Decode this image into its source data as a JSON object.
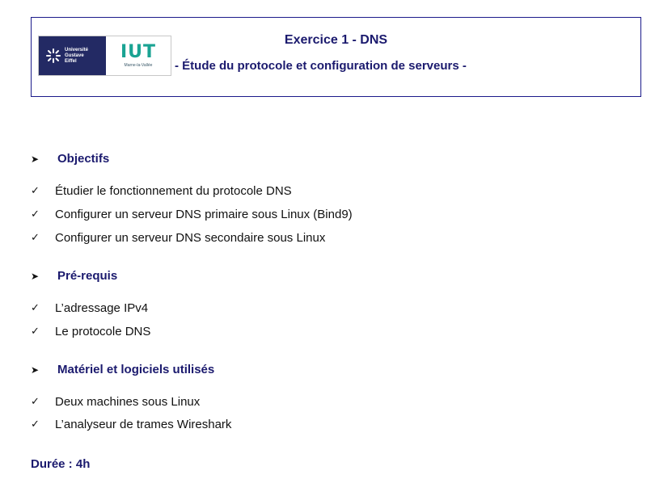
{
  "header": {
    "title": "Exercice 1 - DNS",
    "subtitle": "- Étude du protocole et configuration de serveurs -",
    "logo_uge_text": [
      "Université",
      "Gustave",
      "Eiffel"
    ],
    "logo_iut_mark": "IUT",
    "logo_iut_sub": "Marne-la-Vallée"
  },
  "sections": [
    {
      "heading": "Objectifs",
      "items": [
        "Étudier le fonctionnement du protocole DNS",
        "Configurer un serveur DNS primaire sous Linux (Bind9)",
        "Configurer un serveur DNS secondaire sous Linux"
      ]
    },
    {
      "heading": "Pré-requis",
      "items": [
        "L’adressage IPv4",
        "Le protocole DNS"
      ]
    },
    {
      "heading": "Matériel et logiciels utilisés",
      "items": [
        "Deux machines sous Linux",
        "L’analyseur de trames Wireshark"
      ]
    }
  ],
  "duration": "Durée : 4h",
  "icons": {
    "bullet": "arrowhead-icon",
    "check": "checkmark-icon"
  },
  "colors": {
    "heading": "#1b1a6e",
    "border": "#1b1a8a",
    "uge_background": "#232a64",
    "iut_accent": "#1aa393"
  }
}
